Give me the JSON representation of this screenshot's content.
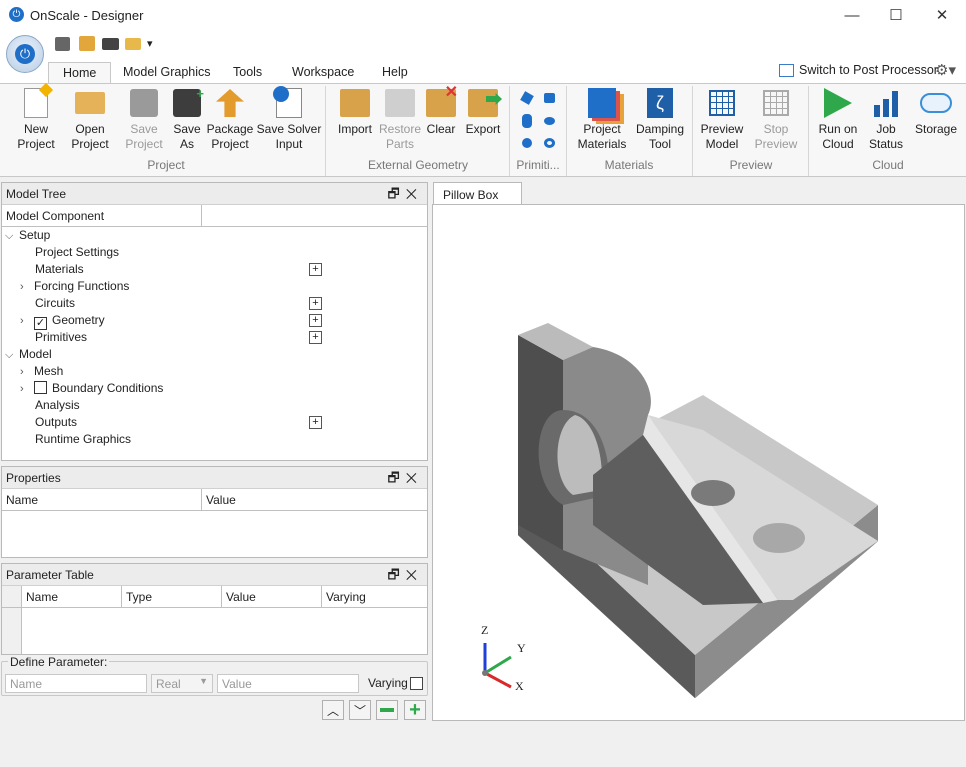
{
  "window": {
    "title": "OnScale - Designer",
    "min": "—",
    "max": "☐",
    "close": "✕"
  },
  "quick": {
    "dropdown": "▾"
  },
  "tabs": [
    "Home",
    "Model Graphics",
    "Tools",
    "Workspace",
    "Help"
  ],
  "post_processor": "Switch to Post Processor",
  "ribbon": {
    "new_project": "New\nProject",
    "open_project": "Open\nProject",
    "save_project": "Save\nProject",
    "save_as": "Save\nAs",
    "package_project": "Package\nProject",
    "save_solver_input": "Save Solver\nInput",
    "import": "Import",
    "restore_parts": "Restore\nParts",
    "clear": "Clear",
    "export": "Export",
    "project_materials": "Project\nMaterials",
    "damping_tool": "Damping\nTool",
    "preview_model": "Preview\nModel",
    "stop_preview": "Stop\nPreview",
    "run_on_cloud": "Run on\nCloud",
    "job_status": "Job\nStatus",
    "storage": "Storage",
    "groups": {
      "project": "Project",
      "external_geometry": "External Geometry",
      "primitives": "Primiti...",
      "materials": "Materials",
      "preview": "Preview",
      "cloud": "Cloud"
    }
  },
  "model_tree": {
    "title": "Model Tree",
    "column": "Model Component",
    "items": {
      "setup": "Setup",
      "project_settings": "Project Settings",
      "materials": "Materials",
      "forcing_functions": "Forcing Functions",
      "circuits": "Circuits",
      "geometry": "Geometry",
      "primitives": "Primitives",
      "model": "Model",
      "mesh": "Mesh",
      "boundary_conditions": "Boundary Conditions",
      "analysis": "Analysis",
      "outputs": "Outputs",
      "runtime_graphics": "Runtime Graphics"
    }
  },
  "properties": {
    "title": "Properties",
    "col_name": "Name",
    "col_value": "Value"
  },
  "parameter_table": {
    "title": "Parameter Table",
    "cols": [
      "Name",
      "Type",
      "Value",
      "Varying"
    ]
  },
  "define_parameter": {
    "legend": "Define Parameter:",
    "name_placeholder": "Name",
    "type_value": "Real",
    "value_placeholder": "Value",
    "varying_label": "Varying"
  },
  "viewport": {
    "tab": "Pillow Box",
    "tab_close": "☒",
    "axis_z": "Z",
    "axis_y": "Y",
    "axis_x": "X"
  }
}
